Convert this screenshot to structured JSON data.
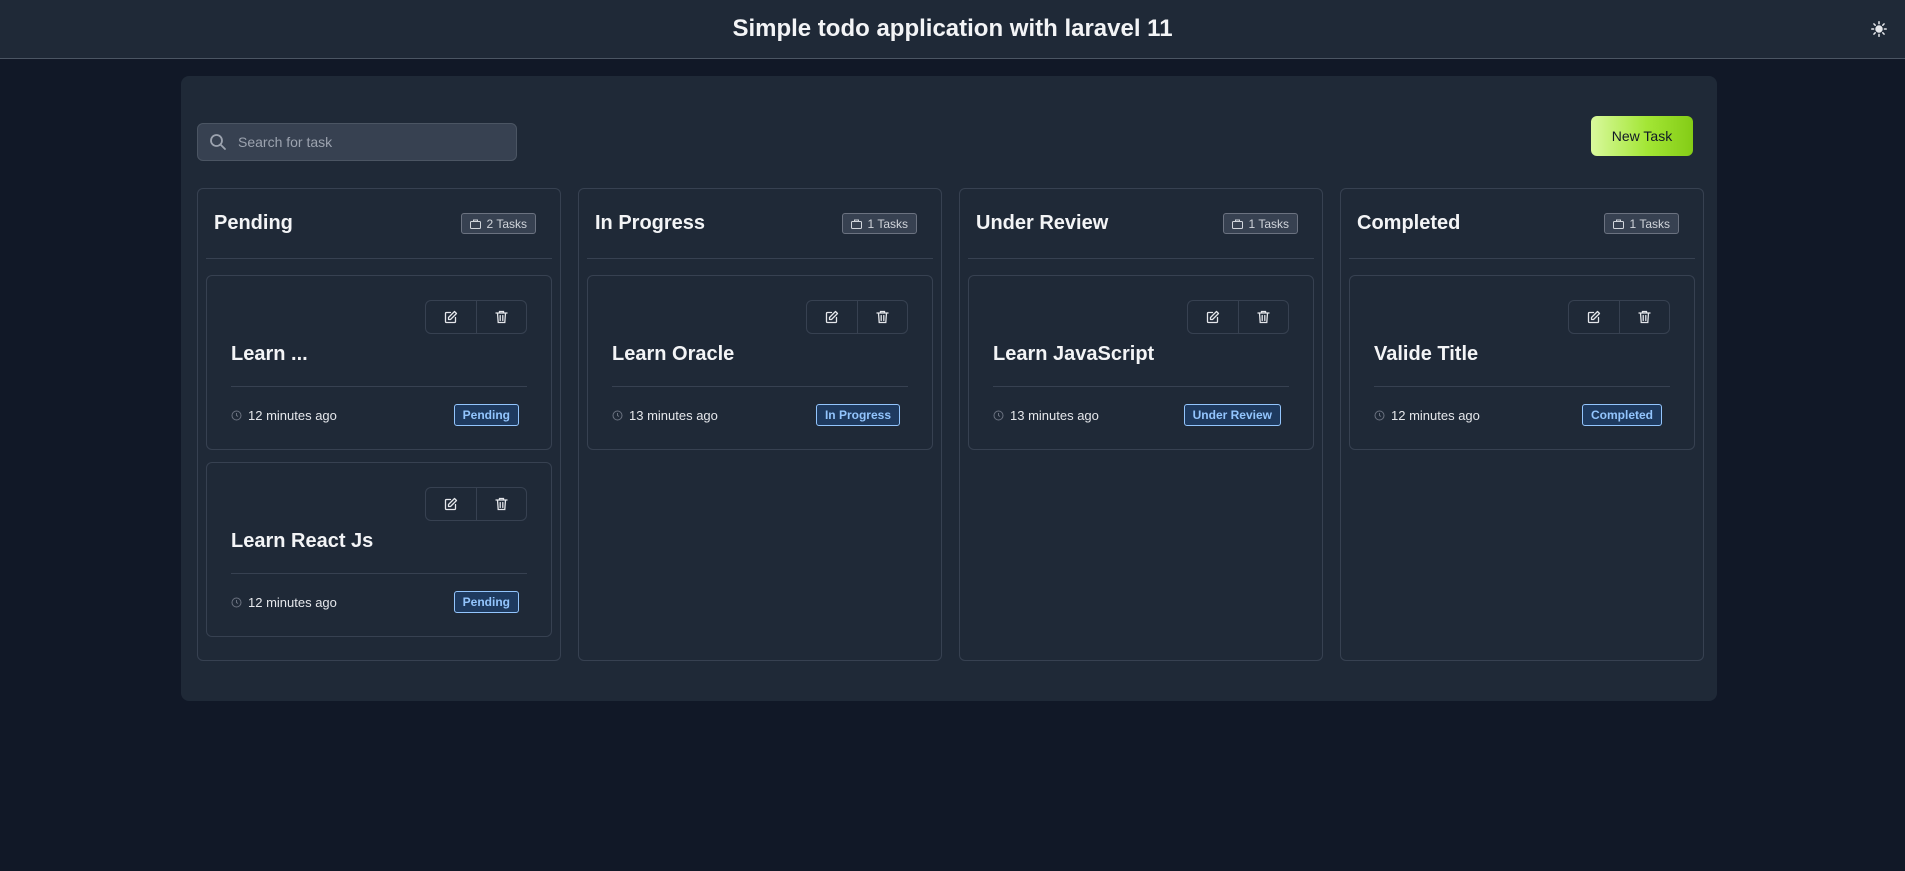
{
  "header": {
    "title": "Simple todo application with laravel 11",
    "theme_icon": "sun-icon"
  },
  "toolbar": {
    "search_placeholder": "Search for task",
    "search_value": "",
    "new_task_label": "New Task"
  },
  "columns": [
    {
      "title": "Pending",
      "count": "2 Tasks",
      "cards": [
        {
          "title": "Learn ...",
          "time": "12 minutes ago",
          "status": "Pending"
        },
        {
          "title": "Learn React Js",
          "time": "12 minutes ago",
          "status": "Pending"
        }
      ]
    },
    {
      "title": "In Progress",
      "count": "1 Tasks",
      "cards": [
        {
          "title": "Learn Oracle",
          "time": "13 minutes ago",
          "status": "In Progress"
        }
      ]
    },
    {
      "title": "Under Review",
      "count": "1 Tasks",
      "cards": [
        {
          "title": "Learn JavaScript",
          "time": "13 minutes ago",
          "status": "Under Review"
        }
      ]
    },
    {
      "title": "Completed",
      "count": "1 Tasks",
      "cards": [
        {
          "title": "Valide Title",
          "time": "12 minutes ago",
          "status": "Completed"
        }
      ]
    }
  ],
  "colors": {
    "background": "#111827",
    "panel": "#1f2937",
    "accent": "#a3e635",
    "status": "#93c5fd"
  }
}
